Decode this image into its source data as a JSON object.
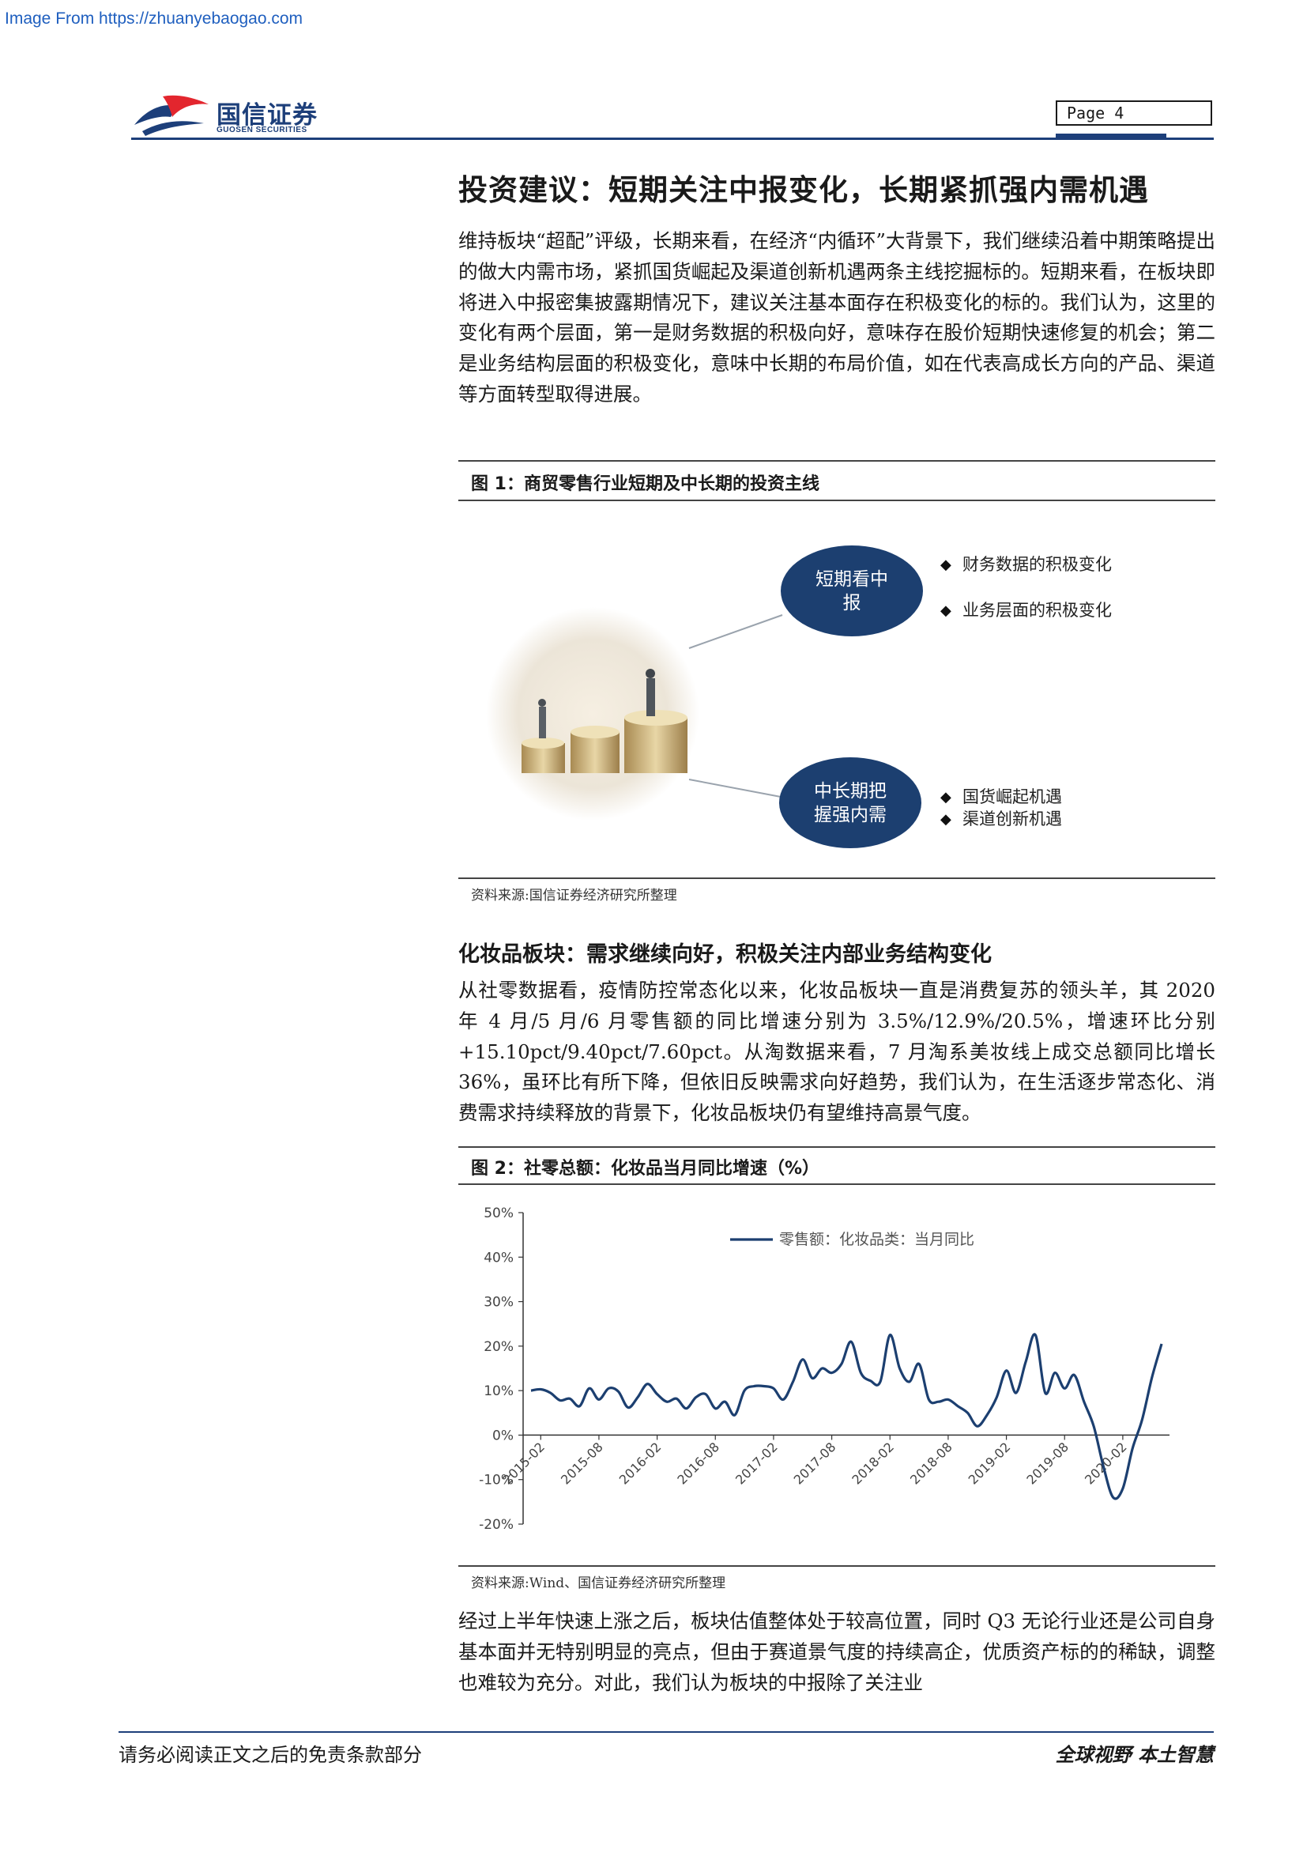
{
  "watermark": "Image From https://zhuanyebaogao.com",
  "header": {
    "logo_cn": "国信证券",
    "logo_en": "GUOSEN SECURITIES",
    "page_label": "Page  4",
    "brand_color": "#1d3f7a",
    "accent_color": "#e3262e"
  },
  "section1": {
    "title": "投资建议：短期关注中报变化，长期紧抓强内需机遇",
    "body": "维持板块“超配”评级，长期来看，在经济“内循环”大背景下，我们继续沿着中期策略提出的做大内需市场，紧抓国货崛起及渠道创新机遇两条主线挖掘标的。短期来看，在板块即将进入中报密集披露期情况下，建议关注基本面存在积极变化的标的。我们认为，这里的变化有两个层面，第一是财务数据的积极向好，意味存在股价短期快速修复的机会；第二是业务结构层面的积极变化，意味中长期的布局价值，如在代表高成长方向的产品、渠道等方面转型取得进展。"
  },
  "figure1": {
    "title": "图 1：商贸零售行业短期及中长期的投资主线",
    "short_term": "短期看中报",
    "short_bullets": [
      "财务数据的积极变化",
      "业务层面的积极变化"
    ],
    "long_term": "中长期把握强内需",
    "long_bullets": [
      "国货崛起机遇",
      "渠道创新机遇"
    ],
    "image_icon": "coins-stack-illustration",
    "source": "资料来源:国信证券经济研究所整理"
  },
  "section2": {
    "title": "化妆品板块：需求继续向好，积极关注内部业务结构变化",
    "body": "从社零数据看，疫情防控常态化以来，化妆品板块一直是消费复苏的领头羊，其 2020 年 4 月/5 月/6 月零售额的同比增速分别为 3.5%/12.9%/20.5%，增速环比分别+15.10pct/9.40pct/7.60pct。从淘数据来看，7 月淘系美妆线上成交总额同比增长 36%，虽环比有所下降，但依旧反映需求向好趋势，我们认为，在生活逐步常态化、消费需求持续释放的背景下，化妆品板块仍有望维持高景气度。"
  },
  "figure2": {
    "title": "图 2：社零总额：化妆品当月同比增速（%）",
    "source": "资料来源:Wind、国信证券经济研究所整理"
  },
  "chart_data": {
    "type": "line",
    "legend_position": "top-center",
    "grid": false,
    "ylim": [
      -20,
      50
    ],
    "y_ticks": [
      "50%",
      "40%",
      "30%",
      "20%",
      "10%",
      "0%",
      "-10%",
      "-20%"
    ],
    "x_ticks": [
      "2015-02",
      "2015-08",
      "2016-02",
      "2016-08",
      "2017-02",
      "2017-08",
      "2018-02",
      "2018-08",
      "2019-02",
      "2019-08",
      "2020-02"
    ],
    "series": [
      {
        "name": "零售额：化妆品类：当月同比",
        "color": "#1c3f70",
        "x": [
          "2015-01",
          "2015-02",
          "2015-03",
          "2015-04",
          "2015-05",
          "2015-06",
          "2015-07",
          "2015-08",
          "2015-09",
          "2015-10",
          "2015-11",
          "2015-12",
          "2016-01",
          "2016-02",
          "2016-03",
          "2016-04",
          "2016-05",
          "2016-06",
          "2016-07",
          "2016-08",
          "2016-09",
          "2016-10",
          "2016-11",
          "2016-12",
          "2017-01",
          "2017-02",
          "2017-03",
          "2017-04",
          "2017-05",
          "2017-06",
          "2017-07",
          "2017-08",
          "2017-09",
          "2017-10",
          "2017-11",
          "2017-12",
          "2018-01",
          "2018-02",
          "2018-03",
          "2018-04",
          "2018-05",
          "2018-06",
          "2018-07",
          "2018-08",
          "2018-09",
          "2018-10",
          "2018-11",
          "2018-12",
          "2019-01",
          "2019-02",
          "2019-03",
          "2019-04",
          "2019-05",
          "2019-06",
          "2019-07",
          "2019-08",
          "2019-09",
          "2019-10",
          "2019-11",
          "2019-12",
          "2020-01",
          "2020-02",
          "2020-03",
          "2020-04",
          "2020-05",
          "2020-06"
        ],
        "values": [
          10,
          10.3,
          9.5,
          7.8,
          8.2,
          6.5,
          10.5,
          8.0,
          10.5,
          9.8,
          6.2,
          8.5,
          11.5,
          9.2,
          7.5,
          8.2,
          6.0,
          8.5,
          9.2,
          6.0,
          7.5,
          4.5,
          10.0,
          11.0,
          11.0,
          10.5,
          8.0,
          12.0,
          17.0,
          12.8,
          15.0,
          14.0,
          16.0,
          21.0,
          14.0,
          12.2,
          12.0,
          22.5,
          15.0,
          12.0,
          16.0,
          8.0,
          7.5,
          8.0,
          6.5,
          5.0,
          2.0,
          4.5,
          8.5,
          14.5,
          9.5,
          16.5,
          22.5,
          9.5,
          14.0,
          10.5,
          13.5,
          7.5,
          2.0,
          -7.0,
          -14.0,
          -12.0,
          -3.0,
          3.5,
          12.9,
          20.5
        ]
      }
    ]
  },
  "section3": {
    "body": "经过上半年快速上涨之后，板块估值整体处于较高位置，同时 Q3 无论行业还是公司自身基本面并无特别明显的亮点，但由于赛道景气度的持续高企，优质资产标的的稀缺，调整也难较为充分。对此，我们认为板块的中报除了关注业"
  },
  "footer": {
    "left": "请务必阅读正文之后的免责条款部分",
    "right": "全球视野  本土智慧"
  }
}
